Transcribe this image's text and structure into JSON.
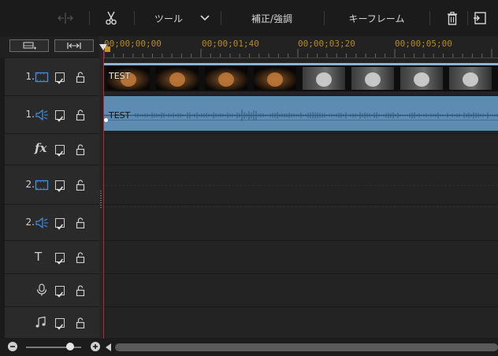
{
  "toolbar": {
    "tools_label": "ツール",
    "correction_label": "補正/強調",
    "keyframe_label": "キーフレーム"
  },
  "ruler": {
    "timecodes": [
      "00;00;00;00",
      "00;00;01;40",
      "00;00;03;20",
      "00;00;05;00"
    ]
  },
  "tracks": [
    {
      "id": "video-1",
      "number": "1.",
      "icon": "video-track-icon"
    },
    {
      "id": "audio-1",
      "number": "1.",
      "icon": "speaker-icon"
    },
    {
      "id": "fx",
      "number": "",
      "icon": "fx-icon",
      "icon_text": "fx"
    },
    {
      "id": "video-2",
      "number": "2.",
      "icon": "video-track-icon"
    },
    {
      "id": "audio-2",
      "number": "2.",
      "icon": "speaker-icon"
    },
    {
      "id": "title",
      "number": "",
      "icon": "title-icon",
      "icon_text": "T"
    },
    {
      "id": "voice",
      "number": "",
      "icon": "microphone-icon"
    },
    {
      "id": "music",
      "number": "",
      "icon": "music-icon"
    }
  ],
  "clips": {
    "video_clip_label": "TEST",
    "audio_clip_label": "TEST"
  },
  "colors": {
    "accent_timecode": "#b98a1e",
    "playhead": "#c8232a",
    "track_icon_blue": "#3d8fe8",
    "clip_blue": "#5d8bb1"
  }
}
